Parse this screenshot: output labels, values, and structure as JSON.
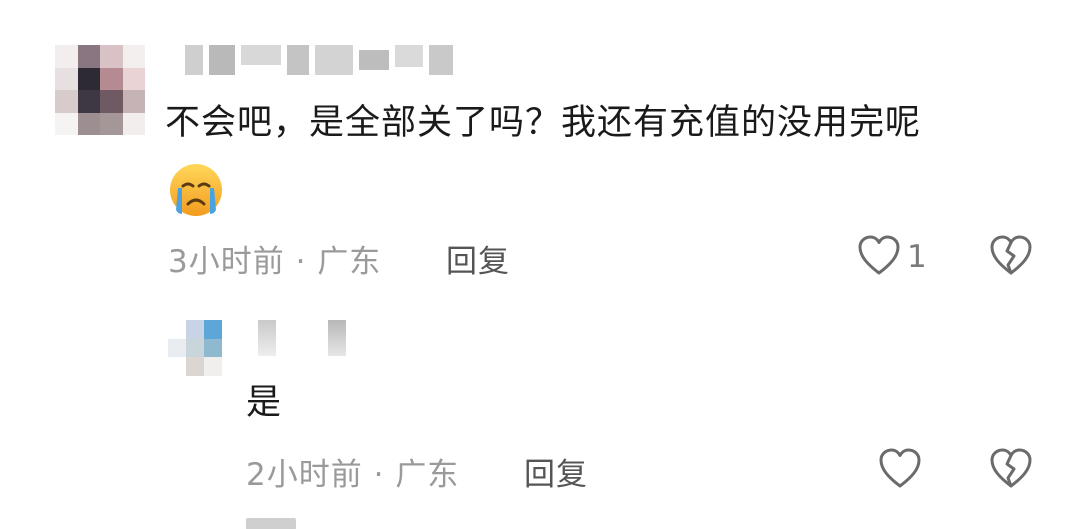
{
  "comments": [
    {
      "text_line1": "不会吧，是全部关了吗？我还有充值的没用完呢",
      "emoji": "crying-face",
      "time": "3小时前",
      "location": "广东",
      "reply_label": "回复",
      "like_count": "1"
    }
  ],
  "replies": [
    {
      "text": "是",
      "time": "2小时前",
      "location": "广东",
      "reply_label": "回复"
    }
  ],
  "separator": "·",
  "colors": {
    "background": "#ffffff",
    "text": "#1a1a1a",
    "meta": "#9a9a9a",
    "emoji_yellow": "#f6b93b",
    "emoji_tear": "#4aa3df"
  },
  "icons": [
    "heart-icon",
    "broken-heart-icon",
    "crying-face-emoji"
  ]
}
